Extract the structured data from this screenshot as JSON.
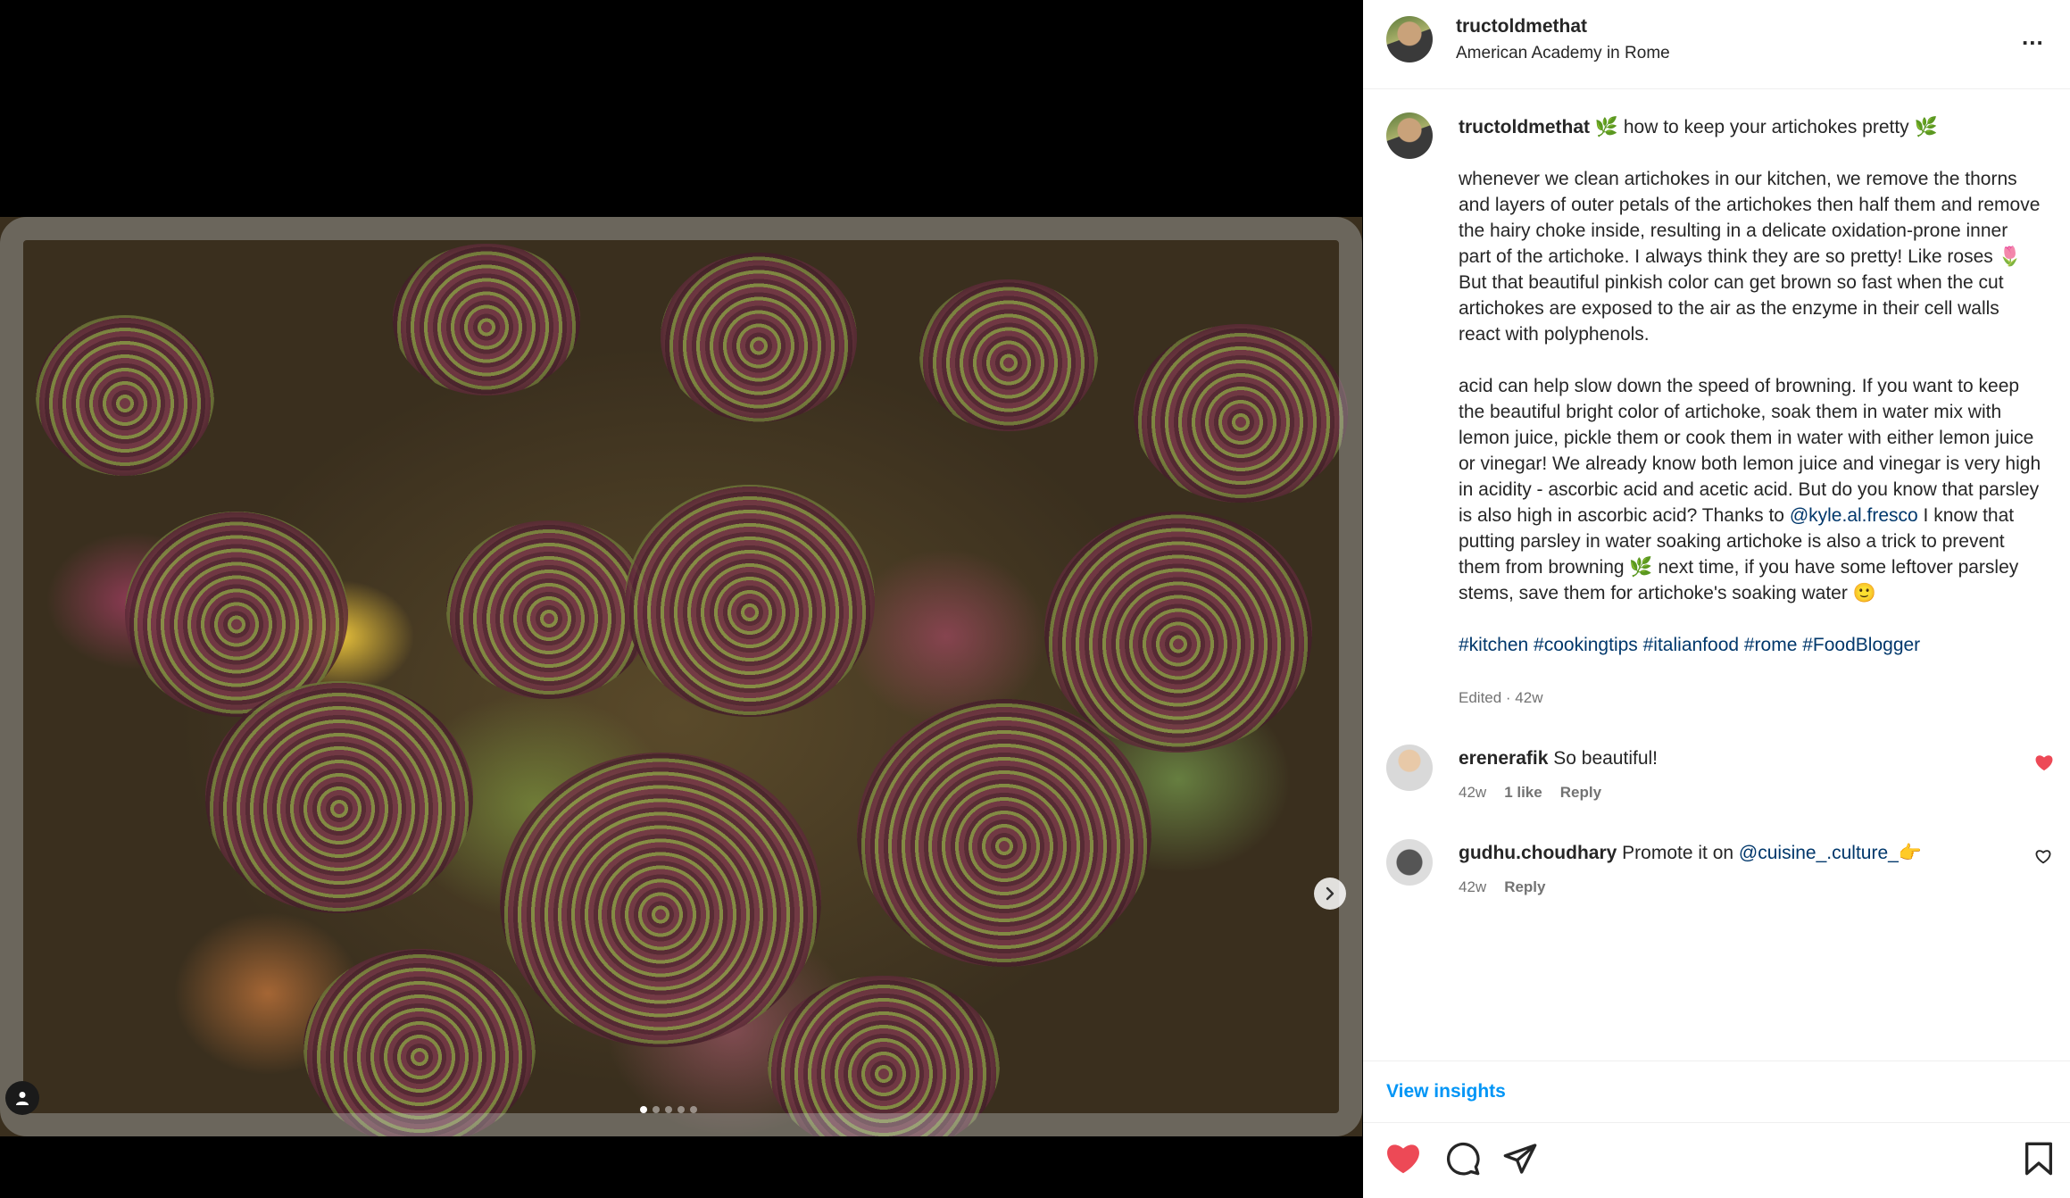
{
  "post": {
    "username": "tructoldmethat",
    "location": "American Academy in Rome",
    "more_label": "..."
  },
  "media": {
    "carousel_total": 5,
    "carousel_active": 1
  },
  "caption": {
    "username": "tructoldmethat",
    "title_emoji": "🌿",
    "title": "how to keep your artichokes pretty",
    "para1_a": "whenever we clean artichokes in our kitchen, we remove the thorns and layers of outer petals of the artichokes then half them and remove the hairy choke inside, resulting in a delicate oxidation-prone inner part of the artichoke. I always think they are so pretty! Like roses",
    "rose_emoji": "🌷",
    "para1_b": "But that beautiful pinkish color can get brown so fast when the cut artichokes are exposed to the air as the enzyme in their cell walls react with polyphenols.",
    "para2_a": "acid can help slow down the speed of browning. If you want to keep the beautiful bright color of artichoke, soak them in water mix with lemon juice, pickle them or cook them in water with either lemon juice or vinegar! We already know both lemon juice and vinegar is very high in acidity - ascorbic acid and acetic acid. But do you know that parsley is also high in ascorbic acid? Thanks to",
    "mention": "@kyle.al.fresco",
    "para2_b": "I know that putting parsley in water soaking artichoke is also a trick to prevent them from browning",
    "leaf_emoji": "🌿",
    "para2_c": "next time, if you have some leftover parsley stems, save them for artichoke's soaking water",
    "smile_emoji": "🙂",
    "hashtags": "#kitchen #cookingtips #italianfood #rome #FoodBlogger",
    "edited": "Edited · 42w"
  },
  "comments": [
    {
      "username": "erenerafik",
      "text": "So beautiful!",
      "time": "42w",
      "likes": "1 like",
      "reply": "Reply",
      "liked": true
    },
    {
      "username": "gudhu.choudhary",
      "text": "Promote it on",
      "mention": "@cuisine_.culture_",
      "emoji": "👉",
      "time": "42w",
      "reply": "Reply",
      "liked": false
    }
  ],
  "insights_label": "View insights",
  "colors": {
    "like_red": "#ed4956",
    "link_blue": "#00376b",
    "insights_blue": "#0095f6",
    "muted": "#737373"
  },
  "icons": {
    "like": "heart-filled-icon",
    "comment": "comment-bubble-icon",
    "share": "paper-plane-icon",
    "save": "bookmark-icon",
    "next": "chevron-right-icon",
    "tag": "person-icon",
    "more": "more-horizontal-icon"
  }
}
